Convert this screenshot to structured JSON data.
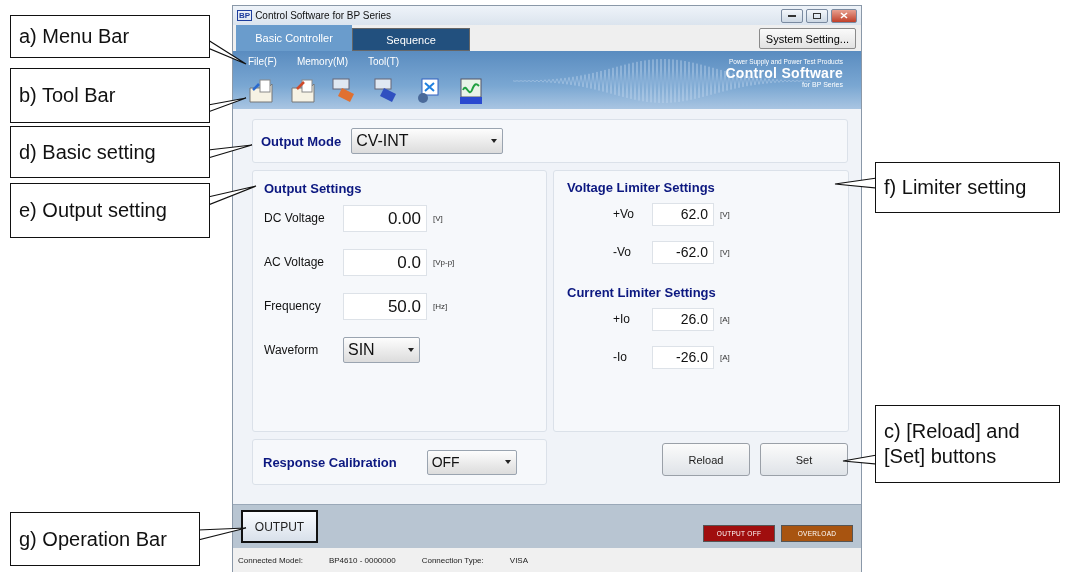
{
  "window": {
    "title": "Control Software for BP Series",
    "logo": "BP"
  },
  "tabs": [
    {
      "label": "Basic Controller",
      "selected": true
    },
    {
      "label": "Sequence",
      "selected": false
    }
  ],
  "system_button": "System Setting...",
  "menu": [
    "File(F)",
    "Memory(M)",
    "Tool(T)"
  ],
  "banner": {
    "tagline": "Power Supply and Power Test Products",
    "title": "Control Software",
    "subtitle": "for BP Series"
  },
  "output_mode": {
    "label": "Output Mode",
    "value": "CV-INT"
  },
  "output_settings": {
    "title": "Output Settings",
    "rows": [
      {
        "kind": "field",
        "label": "DC Voltage",
        "value": "0.00",
        "unit": "[V]"
      },
      {
        "kind": "field",
        "label": "AC Voltage",
        "value": "0.0",
        "unit": "[Vp-p]"
      },
      {
        "kind": "field",
        "label": "Frequency",
        "value": "50.0",
        "unit": "[Hz]"
      },
      {
        "kind": "select",
        "label": "Waveform",
        "value": "SIN"
      }
    ]
  },
  "limiters": [
    {
      "title": "Voltage Limiter Settings",
      "rows": [
        {
          "label": "+Vo",
          "value": "62.0",
          "unit": "[V]"
        },
        {
          "label": "-Vo",
          "value": "-62.0",
          "unit": "[V]"
        }
      ]
    },
    {
      "title": "Current Limiter Settings",
      "rows": [
        {
          "label": "+Io",
          "value": "26.0",
          "unit": "[A]"
        },
        {
          "label": "-Io",
          "value": "-26.0",
          "unit": "[A]"
        }
      ]
    }
  ],
  "response_calibration": {
    "label": "Response Calibration",
    "value": "OFF"
  },
  "buttons": [
    "Reload",
    "Set"
  ],
  "operation_bar": {
    "output_button": "OUTPUT",
    "indicators": [
      {
        "label": "OUTPUT OFF",
        "color": "#a00e0e"
      },
      {
        "label": "OVERLOAD",
        "color": "#a85410"
      }
    ]
  },
  "status_bar": [
    {
      "label": "Connected Model:",
      "value": "BP4610  -  0000000"
    },
    {
      "label": "Connection Type:",
      "value": "VISA"
    }
  ],
  "callouts": [
    {
      "text": "a) Menu Bar"
    },
    {
      "text": "b) Tool Bar"
    },
    {
      "text": "d) Basic setting"
    },
    {
      "text": "e) Output setting"
    },
    {
      "text": "f) Limiter setting"
    },
    {
      "text": "c) [Reload] and [Set] buttons"
    },
    {
      "text": "g) Operation Bar"
    }
  ]
}
